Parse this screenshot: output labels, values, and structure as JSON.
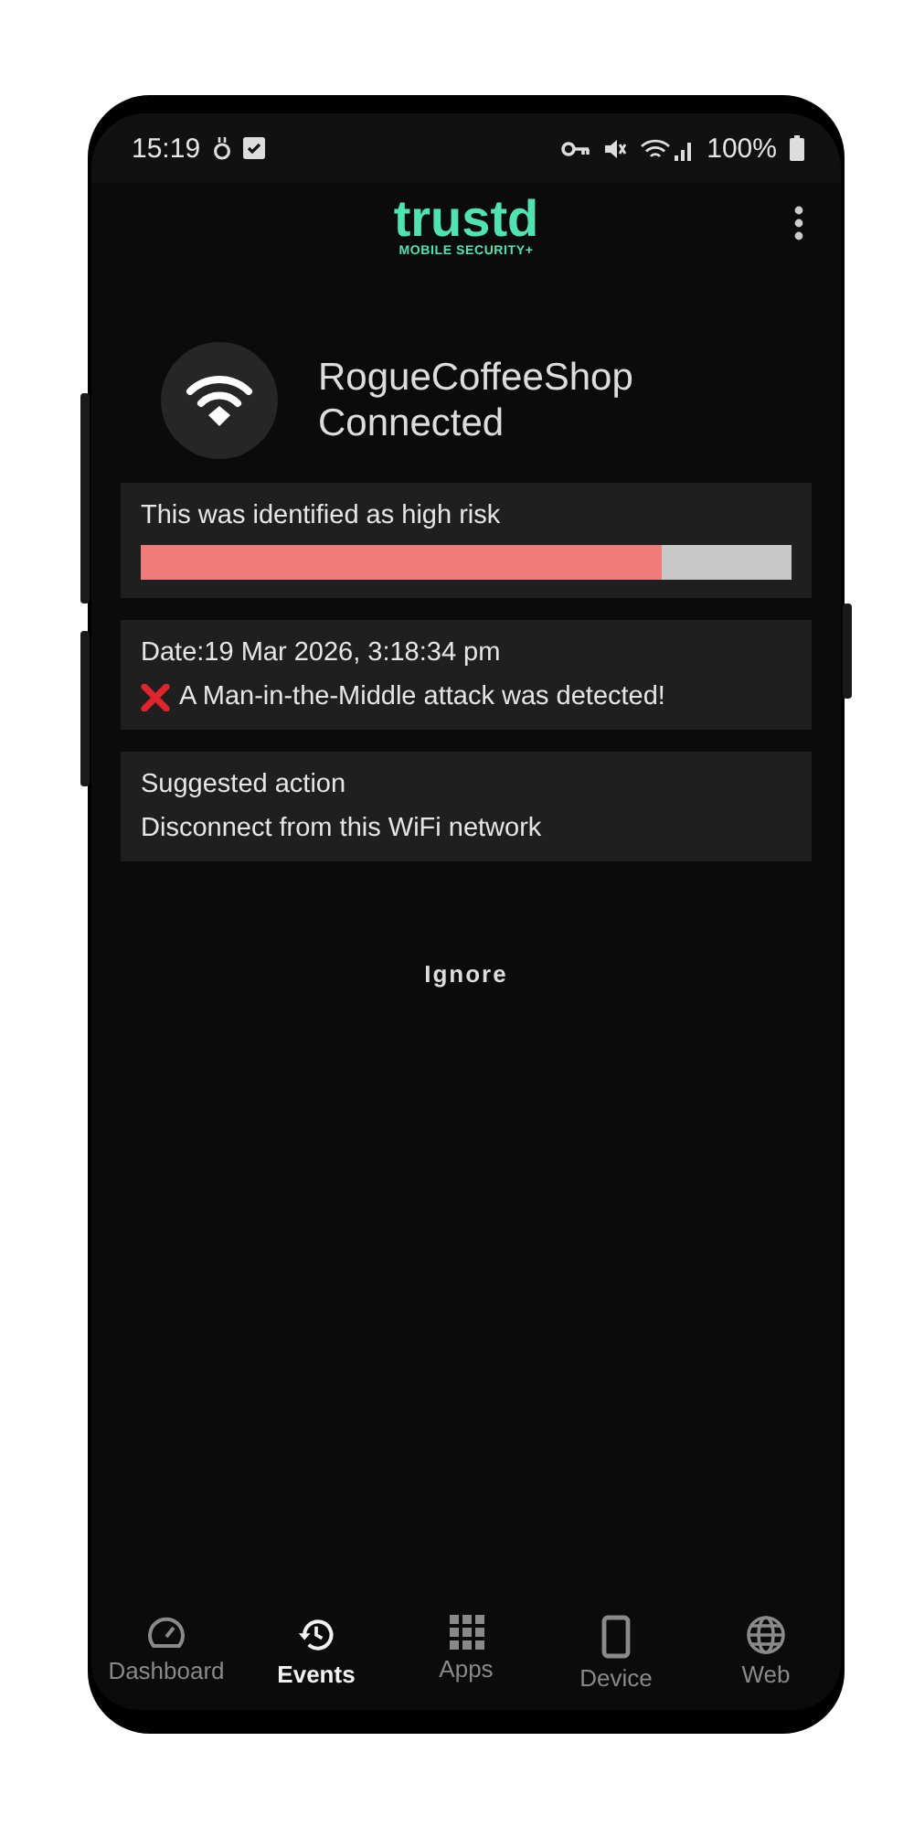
{
  "status_bar": {
    "time": "15:19",
    "battery": "100%"
  },
  "header": {
    "logo": "trustd",
    "tagline": "MOBILE SECURITY+"
  },
  "network": {
    "name": "RogueCoffeeShop",
    "status": "Connected"
  },
  "risk": {
    "label": "This was identified as high risk",
    "level": 0.8
  },
  "event": {
    "date": "Date:19 Mar 2026, 3:18:34 pm",
    "message": "A Man-in-the-Middle attack was detected!"
  },
  "suggestion": {
    "title": "Suggested action",
    "action": "Disconnect from this WiFi network"
  },
  "ignore_button": "Ignore",
  "nav": [
    {
      "label": "Dashboard",
      "kind": "gauge",
      "selected": false
    },
    {
      "label": "Events",
      "kind": "history",
      "selected": true
    },
    {
      "label": "Apps",
      "kind": "grid",
      "selected": false
    },
    {
      "label": "Device",
      "kind": "phone",
      "selected": false
    },
    {
      "label": "Web",
      "kind": "globe",
      "selected": false
    }
  ]
}
